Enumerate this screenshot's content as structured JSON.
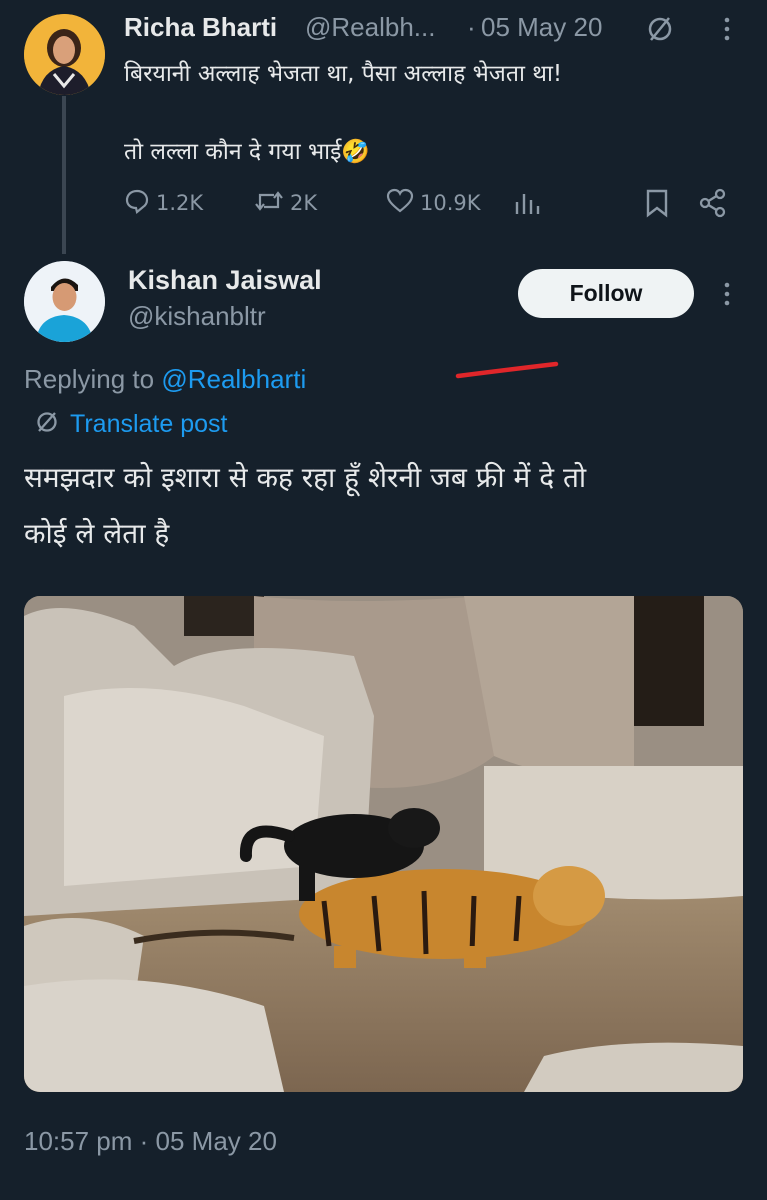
{
  "quoted_tweet": {
    "author_name": "Richa Bharti",
    "handle": "@Realbh...",
    "separator": "·",
    "date": "05 May 20",
    "text_line1": "बिरयानी अल्लाह भेजता था, पैसा अल्लाह भेजता था!",
    "text_line2": "तो लल्ला कौन दे गया भाई🤣",
    "replies": "1.2K",
    "retweets": "2K",
    "likes": "10.9K"
  },
  "reply": {
    "author_name": "Kishan Jaiswal",
    "handle": "@kishanbltr",
    "follow_label": "Follow",
    "replying_to_prefix": "Replying to ",
    "replying_to_handle": "@Realbharti",
    "translate_label": "Translate post",
    "text_line1": "समझदार को इशारा से कह रहा हूँ शेरनी जब फ्री में दे तो",
    "text_line2": "कोई ले लेता है",
    "timestamp": "10:57 pm · 05 May 20"
  },
  "colors": {
    "background": "#15202b",
    "accent": "#1d9bf0",
    "muted": "#8b98a5",
    "annotation_underline": "#e0262a"
  },
  "icons": {
    "reply": "reply-bubble-icon",
    "retweet": "retweet-icon",
    "like": "heart-icon",
    "views": "analytics-icon",
    "bookmark": "bookmark-icon",
    "share": "share-icon",
    "translate": "translate-globe-icon",
    "more": "more-vertical-icon"
  }
}
